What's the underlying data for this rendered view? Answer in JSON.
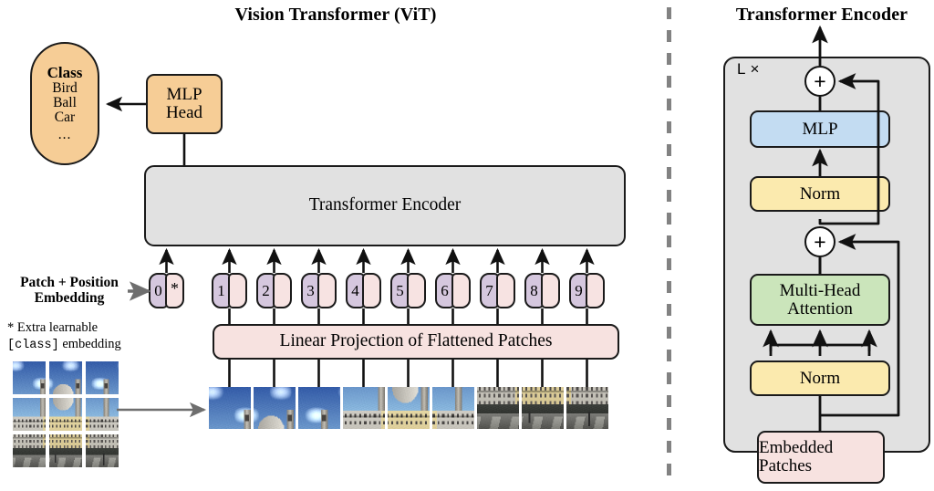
{
  "figure": {
    "left_title": "Vision Transformer (ViT)",
    "right_title": "Transformer Encoder"
  },
  "colors": {
    "orange": "#f6cd96",
    "gray": "#e1e1e1",
    "pink": "#f7e2e0",
    "purple": "#d5c7de",
    "blue": "#c3dcf2",
    "yellow": "#fbeaae",
    "green": "#cbe5bb",
    "outline": "#1a1a1a",
    "divider": "#828282"
  },
  "left_panel": {
    "class_box": {
      "header": "Class",
      "items": [
        "Bird",
        "Ball",
        "Car"
      ],
      "ellipsis": "..."
    },
    "mlp_head": "MLP\nHead",
    "encoder_bar": "Transformer Encoder",
    "linear_projection": "Linear Projection of Flattened Patches",
    "patch_position_label": "Patch + Position\nEmbedding",
    "footnote_line1": "* Extra learnable",
    "footnote_mono": "[class]",
    "footnote_line2_tail": " embedding",
    "tokens": [
      {
        "index": "0",
        "extra": "*"
      },
      {
        "index": "1",
        "extra": ""
      },
      {
        "index": "2",
        "extra": ""
      },
      {
        "index": "3",
        "extra": ""
      },
      {
        "index": "4",
        "extra": ""
      },
      {
        "index": "5",
        "extra": ""
      },
      {
        "index": "6",
        "extra": ""
      },
      {
        "index": "7",
        "extra": ""
      },
      {
        "index": "8",
        "extra": ""
      },
      {
        "index": "9",
        "extra": ""
      }
    ],
    "patch_grid_caption": "3x3 image patch grid",
    "flattened_patch_count": 9
  },
  "right_panel": {
    "repeat_label": "L ×",
    "blocks": {
      "mlp": "MLP",
      "norm_upper": "Norm",
      "multi_head_attention": "Multi-Head\nAttention",
      "norm_lower": "Norm",
      "embedded_patches": "Embedded\nPatches"
    },
    "add_symbol": "+",
    "residual_count": 2,
    "attention_arrow_count": 3
  },
  "chart_data": {
    "type": "diagram",
    "title": "Vision Transformer (ViT)",
    "nodes": [
      "Class",
      "MLP Head",
      "Transformer Encoder",
      "Patch + Position Embedding",
      "Linear Projection of Flattened Patches",
      "Embedded Patches",
      "Norm",
      "Multi-Head Attention",
      "Norm",
      "MLP"
    ]
  }
}
